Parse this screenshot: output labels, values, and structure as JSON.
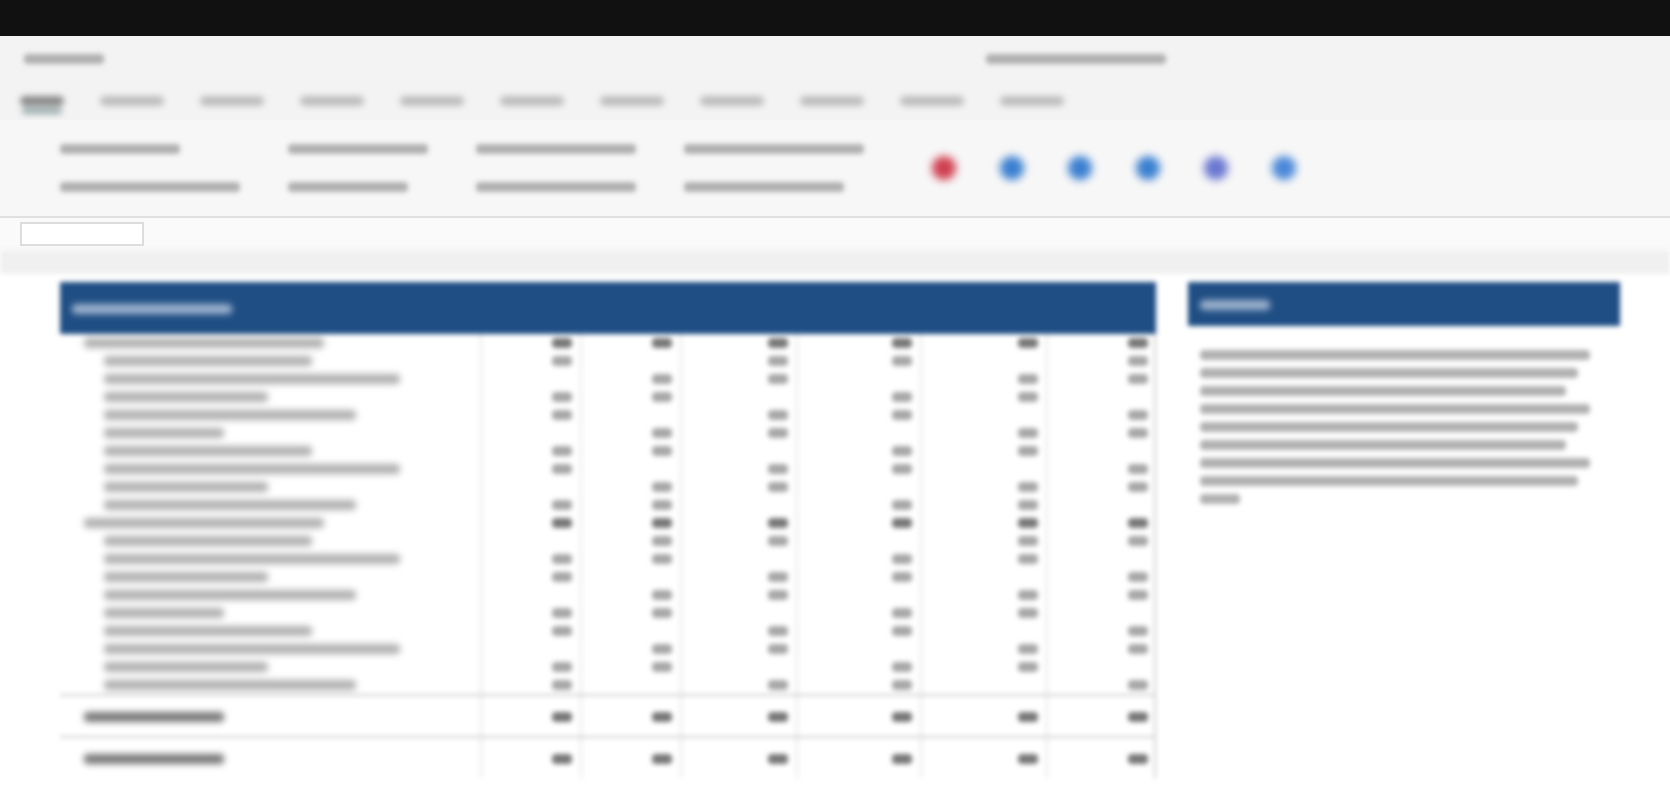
{
  "ribbon": {
    "tabs": [
      {
        "selected": true
      },
      {
        "selected": false
      },
      {
        "selected": false
      },
      {
        "selected": false
      },
      {
        "selected": false
      },
      {
        "selected": false
      },
      {
        "selected": false
      },
      {
        "selected": false
      },
      {
        "selected": false
      },
      {
        "selected": false
      },
      {
        "selected": false
      }
    ],
    "icons": [
      {
        "color": "#d04050"
      },
      {
        "color": "#3a7fd0"
      },
      {
        "color": "#3a7fd0"
      },
      {
        "color": "#3a7fd0"
      },
      {
        "color": "#6a78d0"
      },
      {
        "color": "#4a88d8"
      }
    ]
  },
  "table": {
    "rows": [
      {
        "kind": "section"
      },
      {
        "kind": "item"
      },
      {
        "kind": "item"
      },
      {
        "kind": "item"
      },
      {
        "kind": "item"
      },
      {
        "kind": "item"
      },
      {
        "kind": "item"
      },
      {
        "kind": "item"
      },
      {
        "kind": "item"
      },
      {
        "kind": "item"
      },
      {
        "kind": "section"
      },
      {
        "kind": "item"
      },
      {
        "kind": "item"
      },
      {
        "kind": "item"
      },
      {
        "kind": "item"
      },
      {
        "kind": "item"
      },
      {
        "kind": "item"
      },
      {
        "kind": "item"
      },
      {
        "kind": "item"
      },
      {
        "kind": "item"
      },
      {
        "kind": "total"
      },
      {
        "kind": "total"
      }
    ]
  },
  "notes": {
    "lines": [
      {
        "kind": "full"
      },
      {
        "kind": "full"
      },
      {
        "kind": "full"
      },
      {
        "kind": "full"
      },
      {
        "kind": "full"
      },
      {
        "kind": "full"
      },
      {
        "kind": "full"
      },
      {
        "kind": "full"
      },
      {
        "kind": "end"
      }
    ]
  }
}
